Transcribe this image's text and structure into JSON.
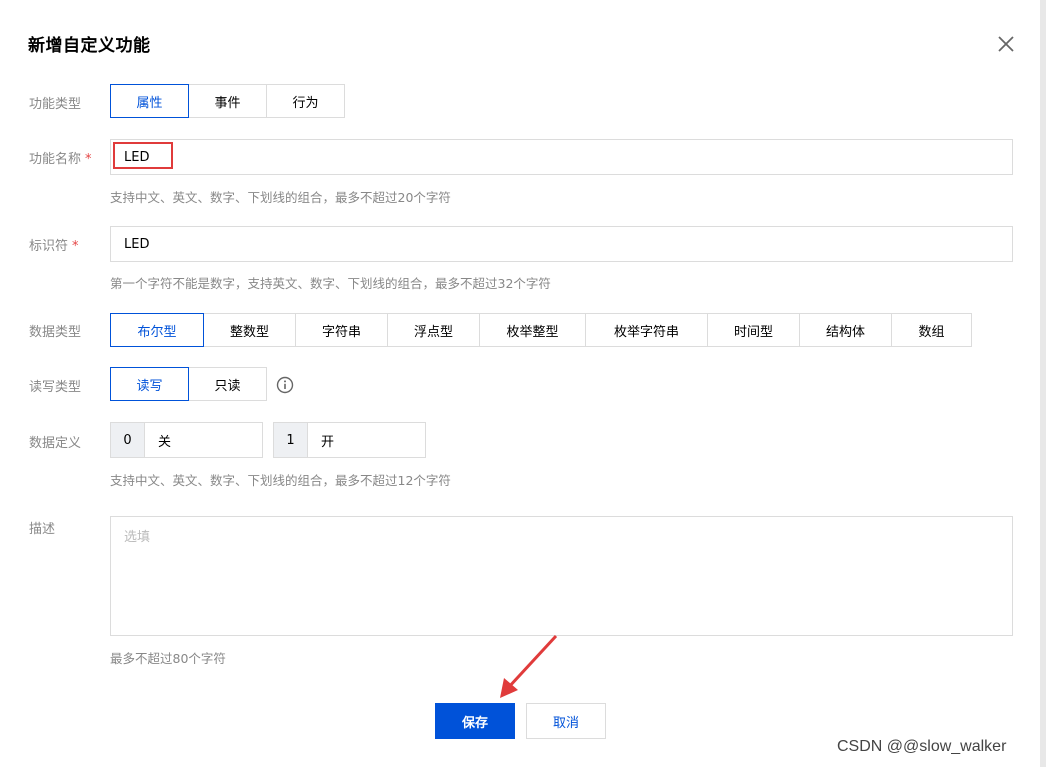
{
  "dialog": {
    "title": "新增自定义功能",
    "close_icon": "close-icon"
  },
  "form": {
    "function_type": {
      "label": "功能类型",
      "options": [
        "属性",
        "事件",
        "行为"
      ],
      "selected": "属性"
    },
    "function_name": {
      "label": "功能名称",
      "required_mark": "*",
      "value": "LED",
      "hint": "支持中文、英文、数字、下划线的组合，最多不超过20个字符"
    },
    "identifier": {
      "label": "标识符",
      "required_mark": "*",
      "value": "LED",
      "hint": "第一个字符不能是数字，支持英文、数字、下划线的组合，最多不超过32个字符"
    },
    "data_type": {
      "label": "数据类型",
      "options": [
        "布尔型",
        "整数型",
        "字符串",
        "浮点型",
        "枚举整型",
        "枚举字符串",
        "时间型",
        "结构体",
        "数组"
      ],
      "selected": "布尔型"
    },
    "rw_type": {
      "label": "读写类型",
      "options": [
        "读写",
        "只读"
      ],
      "selected": "读写",
      "info_icon": "info-circle-icon"
    },
    "data_definition": {
      "label": "数据定义",
      "entries": [
        {
          "key": "0",
          "value": "关"
        },
        {
          "key": "1",
          "value": "开"
        }
      ],
      "hint": "支持中文、英文、数字、下划线的组合，最多不超过12个字符"
    },
    "description": {
      "label": "描述",
      "placeholder": "选填",
      "hint": "最多不超过80个字符"
    }
  },
  "actions": {
    "save_label": "保存",
    "cancel_label": "取消"
  },
  "annotation": {
    "highlight_color": "#e03b3b",
    "arrow_icon": "red-arrow-icon"
  },
  "watermark": "CSDN @@slow_walker",
  "colors": {
    "accent": "#0052d9",
    "border": "#dcdcdc",
    "label": "#888888",
    "required": "#e54545"
  }
}
